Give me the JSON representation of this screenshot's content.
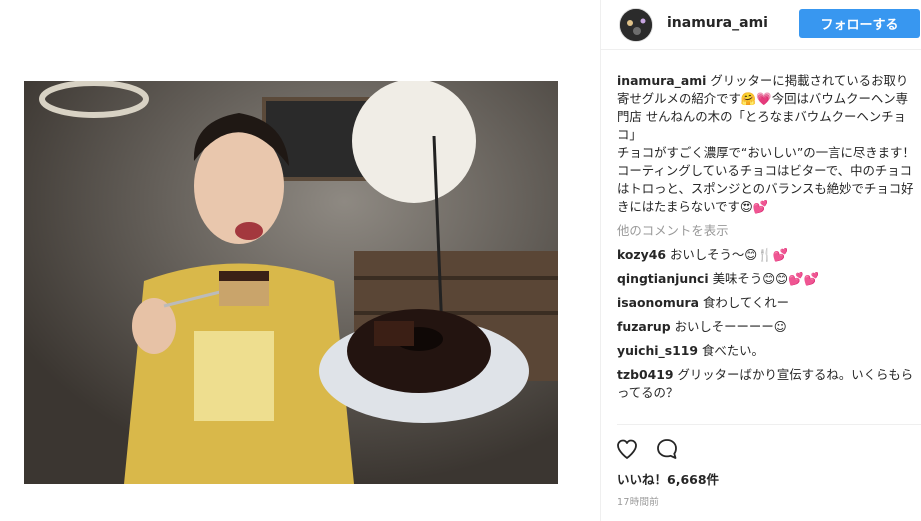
{
  "post": {
    "username": "inamura_ami",
    "follow_label": "フォローする",
    "caption_user": "inamura_ami",
    "caption_text": "グリッターに掲載されているお取り寄せグルメの紹介です🤗💗今回はバウムクーヘン専門店 せんねんの木の「とろなまバウムクーヘンチョコ」\nチョコがすごく濃厚で“おいしい”の一言に尽きます！　コーティングしているチョコはビターで、中のチョコはトロっと、スポンジとのバランスも絶妙でチョコ好きにはたまらないです😍💕",
    "more_comments_label": "他のコメントを表示",
    "comments": [
      {
        "user": "kozy46",
        "text": "おいしそう〜😊🍴💕"
      },
      {
        "user": "qingtianjunci",
        "text": "美味そう😊😊💕💕"
      },
      {
        "user": "isaonomura",
        "text": "食わしてくれー"
      },
      {
        "user": "fuzarup",
        "text": "おいしそーーーー☺"
      },
      {
        "user": "yuichi_s119",
        "text": "食べたい。"
      },
      {
        "user": "tzb0419",
        "text": "グリッターばかり宣伝するね。いくらもらってるの？"
      }
    ],
    "likes_text": "いいね！6,668件",
    "time_text": "17時間前"
  },
  "icons": {
    "like": "heart-outline-icon",
    "comment": "comment-bubble-icon"
  },
  "colors": {
    "follow_button": "#3897f0",
    "muted_text": "#999999",
    "text": "#262626"
  }
}
